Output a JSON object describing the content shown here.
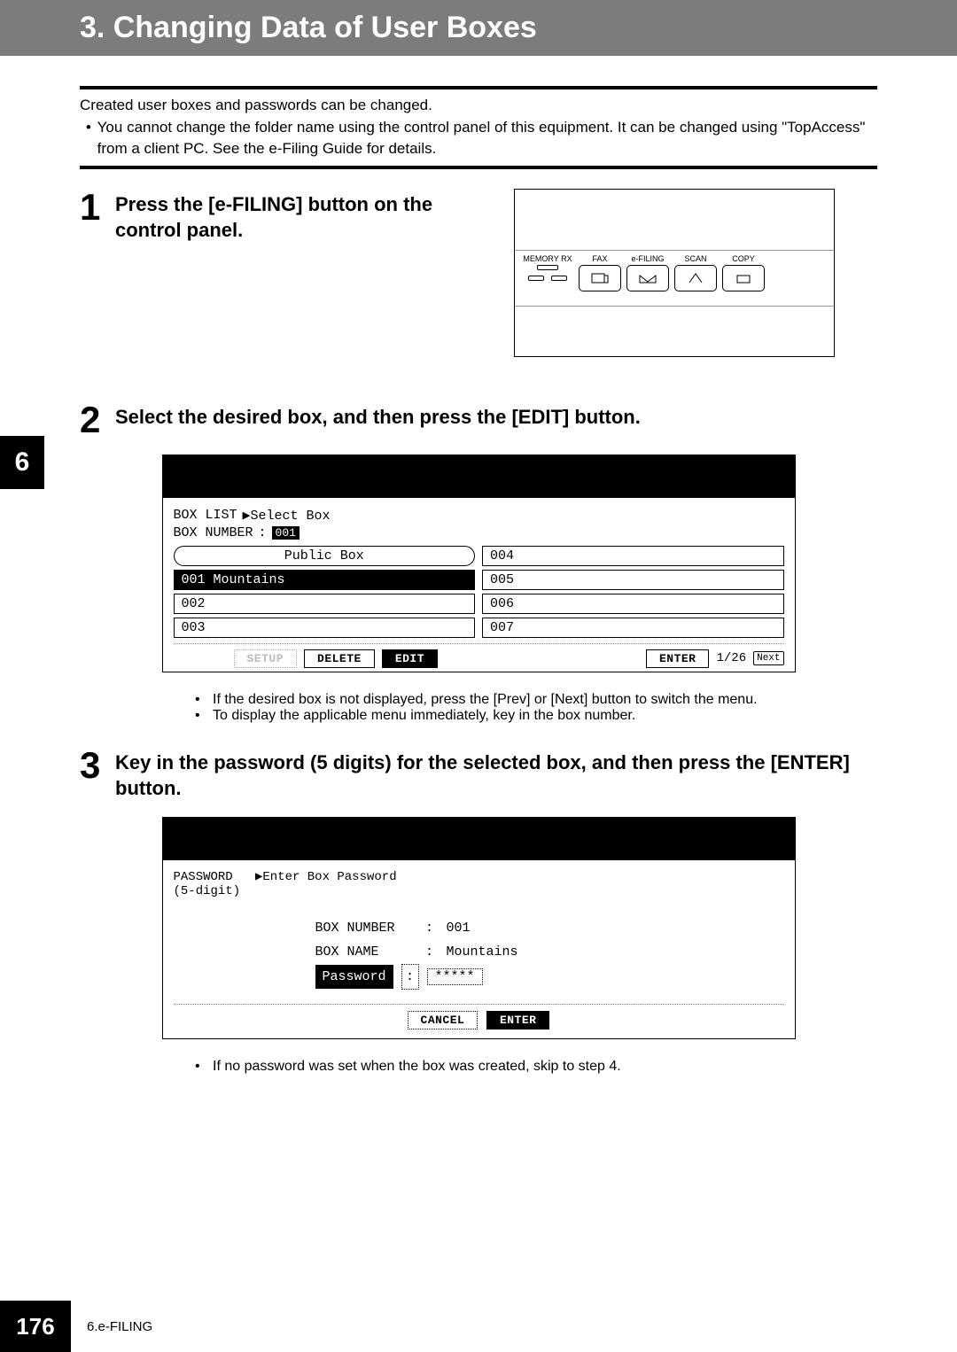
{
  "title": "3. Changing Data of User Boxes",
  "intro": {
    "lead": "Created user boxes and passwords can be changed.",
    "bullet": "You cannot change the folder name using the control panel of this equipment. It can be changed using \"TopAccess\" from a client PC. See the e-Filing Guide for details."
  },
  "chapter_tab": "6",
  "steps": {
    "s1": {
      "num": "1",
      "text": "Press the [e-FILING] button on the control panel."
    },
    "s2": {
      "num": "2",
      "text": "Select the desired box, and then press the [EDIT] button."
    },
    "s3": {
      "num": "3",
      "text": "Key in the password (5 digits) for the selected box, and then press the [ENTER] button."
    }
  },
  "panel_labels": {
    "memory_rx": "MEMORY RX",
    "fax": "FAX",
    "efiling": "e-FILING",
    "scan": "SCAN",
    "copy": "COPY"
  },
  "screen2": {
    "box_list": "BOX LIST",
    "select_box": "▶Select Box",
    "box_number_label": "BOX NUMBER",
    "box_number_value": "001",
    "left": [
      "Public Box",
      "001 Mountains",
      "002",
      "003"
    ],
    "right": [
      "004",
      "005",
      "006",
      "007"
    ],
    "actions": {
      "setup": "SETUP",
      "delete": "DELETE",
      "edit": "EDIT",
      "enter": "ENTER",
      "page": "1/26",
      "next": "Next"
    }
  },
  "notes2": [
    "If the desired box is not displayed, press the [Prev] or [Next] button to switch the menu.",
    "To display the applicable menu immediately, key in the box number."
  ],
  "screen3": {
    "pw_header1": "PASSWORD",
    "pw_header2": "▶Enter Box Password",
    "pw_header3": "(5-digit)",
    "box_number_label": "BOX NUMBER",
    "box_number_value": "001",
    "box_name_label": "BOX NAME",
    "box_name_value": "Mountains",
    "password_label": "Password",
    "password_value": "*****",
    "cancel": "CANCEL",
    "enter": "ENTER"
  },
  "notes3": [
    "If no password was set when the box was created, skip to step 4."
  ],
  "footer": {
    "page": "176",
    "section": "6.e-FILING"
  }
}
